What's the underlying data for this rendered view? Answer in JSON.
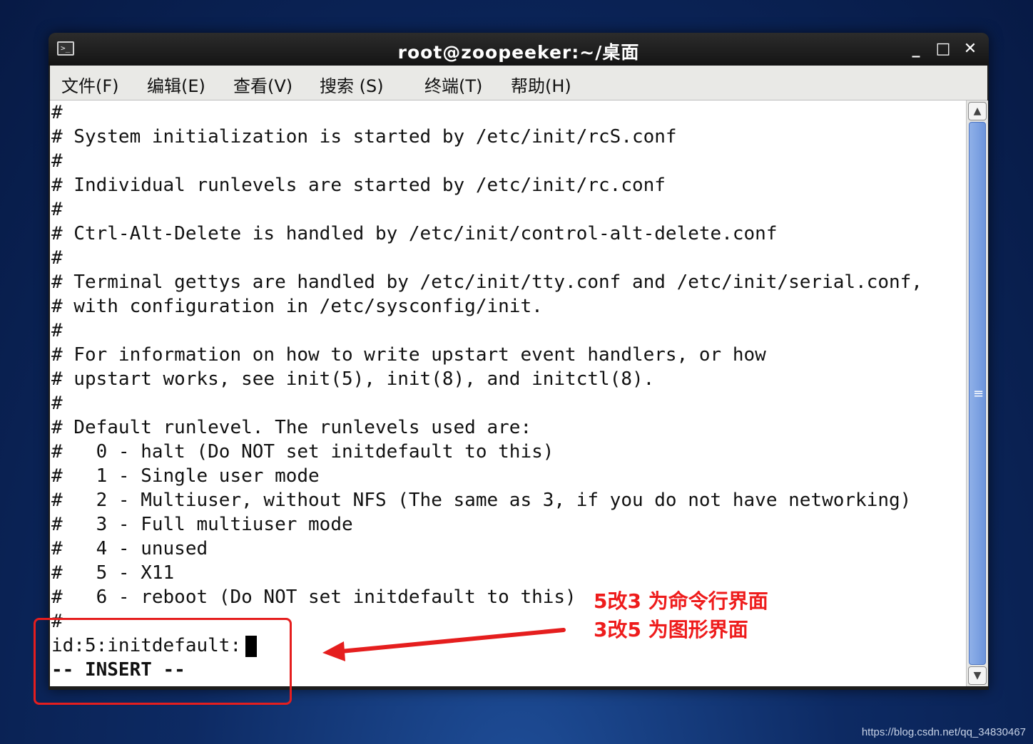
{
  "window": {
    "title": "root@zoopeeker:~/桌面",
    "icon_glyph": ">_",
    "controls": {
      "minimize": "_",
      "maximize": "□",
      "close": "✕"
    }
  },
  "menu": [
    "文件(F)",
    "编辑(E)",
    "查看(V)",
    "搜索 (S)",
    "终端(T)",
    "帮助(H)"
  ],
  "terminal_lines": [
    "#",
    "# System initialization is started by /etc/init/rcS.conf",
    "#",
    "# Individual runlevels are started by /etc/init/rc.conf",
    "#",
    "# Ctrl-Alt-Delete is handled by /etc/init/control-alt-delete.conf",
    "#",
    "# Terminal gettys are handled by /etc/init/tty.conf and /etc/init/serial.conf,",
    "# with configuration in /etc/sysconfig/init.",
    "#",
    "# For information on how to write upstart event handlers, or how",
    "# upstart works, see init(5), init(8), and initctl(8).",
    "#",
    "# Default runlevel. The runlevels used are:",
    "#   0 - halt (Do NOT set initdefault to this)",
    "#   1 - Single user mode",
    "#   2 - Multiuser, without NFS (The same as 3, if you do not have networking)",
    "#   3 - Full multiuser mode",
    "#   4 - unused",
    "#   5 - X11",
    "#   6 - reboot (Do NOT set initdefault to this)",
    "#",
    "id:5:initdefault:"
  ],
  "vim_status": "-- INSERT --",
  "annotation": {
    "line1": "5改3 为命令行界面",
    "line2": "3改5 为图形界面",
    "color": "#ee1c1c"
  },
  "scrollbar": {
    "up": "▲",
    "down": "▼",
    "grip": "≡"
  },
  "watermark": "https://blog.csdn.net/qq_34830467"
}
